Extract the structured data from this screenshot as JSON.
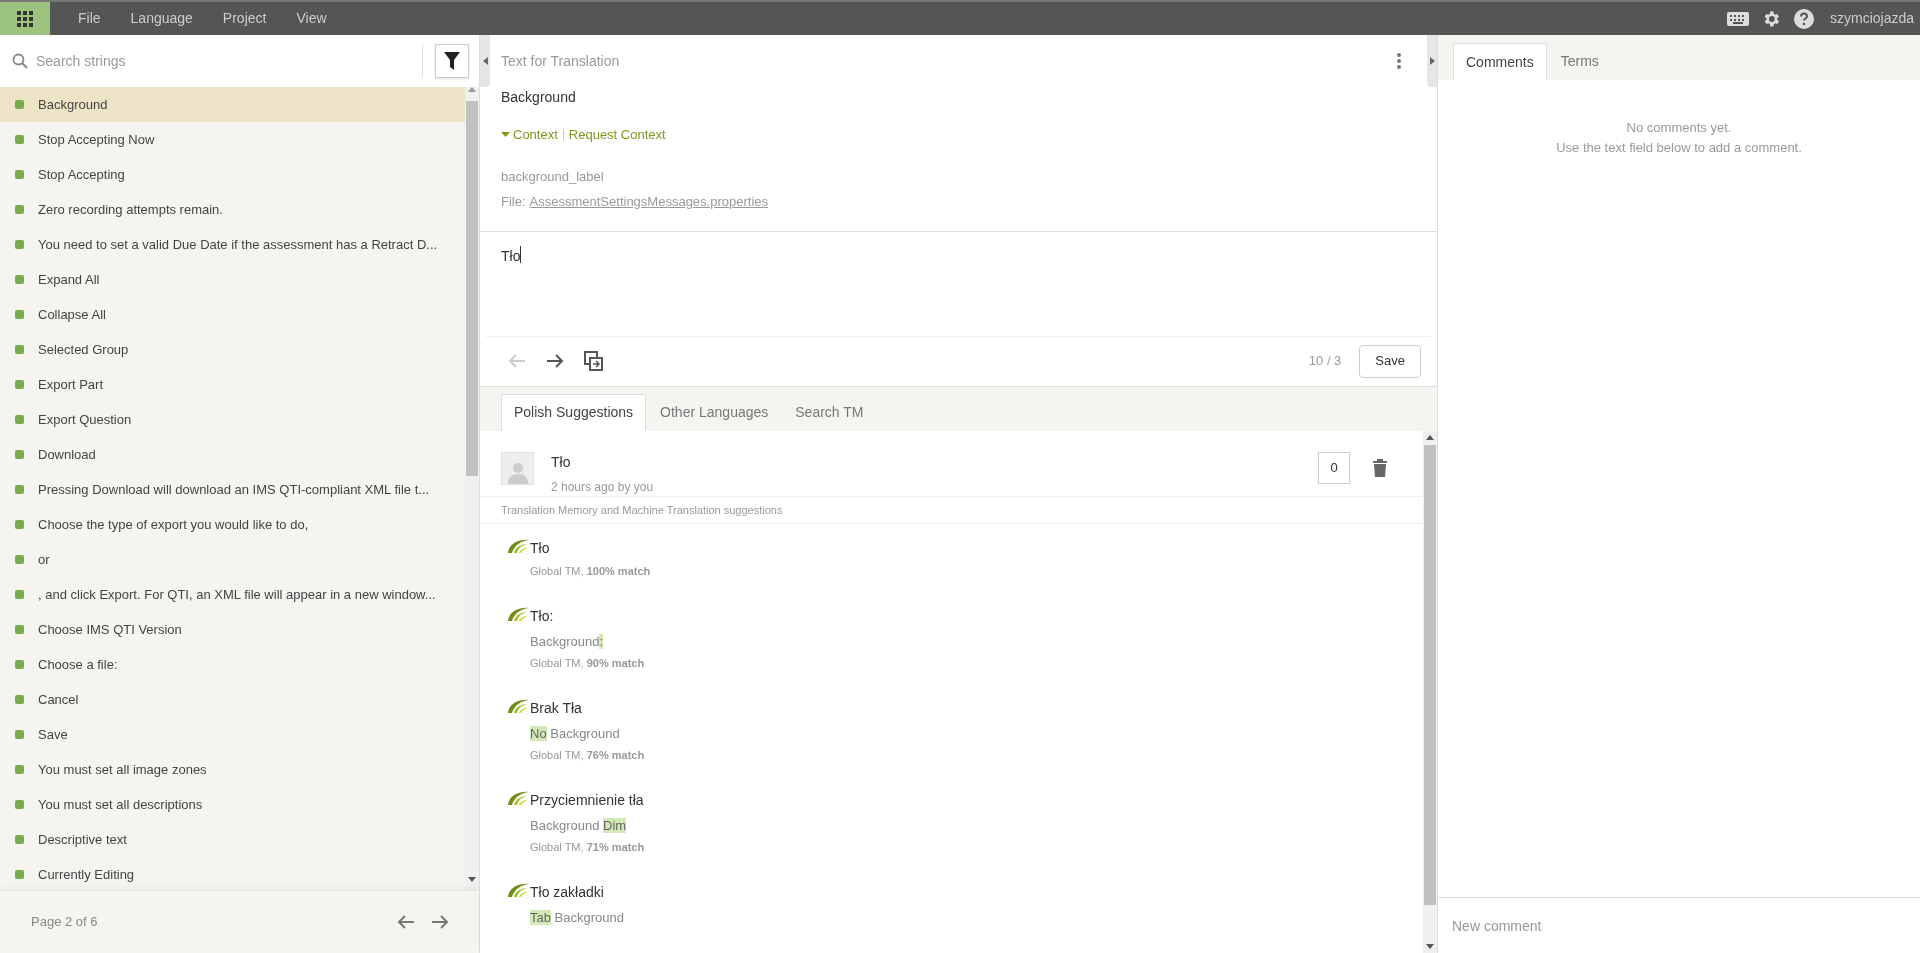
{
  "menu": {
    "items": [
      "File",
      "Language",
      "Project",
      "View"
    ],
    "user": "szymciojazda"
  },
  "strings": {
    "search_placeholder": "Search strings",
    "items": [
      {
        "text": "Background",
        "selected": true
      },
      {
        "text": "Stop Accepting Now",
        "selected": false
      },
      {
        "text": "Stop Accepting",
        "selected": false
      },
      {
        "text": "Zero recording attempts remain.",
        "selected": false
      },
      {
        "text": "You need to set a valid Due Date if the assessment has a Retract D...",
        "selected": false
      },
      {
        "text": "Expand All",
        "selected": false
      },
      {
        "text": "Collapse All",
        "selected": false
      },
      {
        "text": "Selected Group",
        "selected": false
      },
      {
        "text": "Export Part",
        "selected": false
      },
      {
        "text": "Export Question",
        "selected": false
      },
      {
        "text": "Download",
        "selected": false
      },
      {
        "text": "Pressing Download will download an IMS QTI-compliant XML file t...",
        "selected": false
      },
      {
        "text": "Choose the type of export you would like to do,",
        "selected": false
      },
      {
        "text": "or",
        "selected": false
      },
      {
        "text": ", and click Export. For QTI, an XML file will appear in a new window...",
        "selected": false
      },
      {
        "text": "Choose IMS QTI Version",
        "selected": false
      },
      {
        "text": "Choose a file:",
        "selected": false
      },
      {
        "text": "Cancel",
        "selected": false
      },
      {
        "text": "Save",
        "selected": false
      },
      {
        "text": "You must set all image zones",
        "selected": false
      },
      {
        "text": "You must set all descriptions",
        "selected": false
      },
      {
        "text": "Descriptive text",
        "selected": false
      },
      {
        "text": "Currently Editing",
        "selected": false
      }
    ],
    "page": "Page 2 of 6"
  },
  "source": {
    "header": "Text for Translation",
    "text": "Background",
    "context_link": "Context",
    "request_link": "Request Context",
    "key": "background_label",
    "file_label": "File:",
    "file_name": "AssessmentSettingsMessages.properties"
  },
  "editor": {
    "value": "Tło",
    "counter": "10 / 3",
    "save": "Save"
  },
  "suggestion_tabs": [
    {
      "label": "Polish Suggestions",
      "selected": true
    },
    {
      "label": "Other Languages",
      "selected": false
    },
    {
      "label": "Search TM",
      "selected": false
    }
  ],
  "own_suggestion": {
    "text": "Tło",
    "meta": "2 hours ago by you",
    "votes": "0"
  },
  "tm_heading": "Translation Memory and Machine Translation suggestions",
  "tm_suggestions": [
    {
      "text": "Tło",
      "meta": "Global TM, **100% match**"
    },
    {
      "text": "Tło:",
      "source": [
        {
          "text": "Background",
          "highlight": false
        },
        {
          "text": ":",
          "highlight": true
        }
      ],
      "meta": "Global TM, **90% match**"
    },
    {
      "text": "Brak Tła",
      "source": [
        {
          "text": "No",
          "highlight": true
        },
        {
          "text": " Background",
          "highlight": false
        }
      ],
      "meta": "Global TM, **76% match**"
    },
    {
      "text": "Przyciemnienie tła",
      "source": [
        {
          "text": "Background ",
          "highlight": false
        },
        {
          "text": "Dim",
          "highlight": true
        }
      ],
      "meta": "Global TM, **71% match**"
    },
    {
      "text": "Tło zakładki",
      "source": [
        {
          "text": "Tab",
          "highlight": true
        },
        {
          "text": " Background",
          "highlight": false
        }
      ]
    }
  ],
  "side_tabs": [
    {
      "label": "Comments",
      "selected": true
    },
    {
      "label": "Terms",
      "selected": false
    }
  ],
  "comments": {
    "empty_line_1": "No comments yet.",
    "empty_line_2": "Use the text field below to add a comment.",
    "placeholder": "New comment"
  }
}
